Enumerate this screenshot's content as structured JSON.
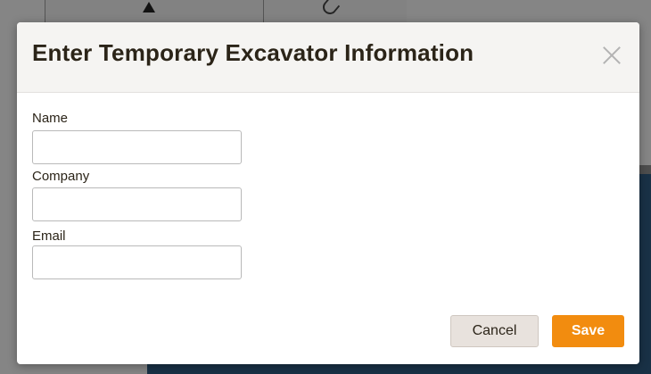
{
  "dialog": {
    "title": "Enter Temporary Excavator Information",
    "close_icon": "close-icon",
    "fields": [
      {
        "label": "Name",
        "value": "",
        "placeholder": ""
      },
      {
        "label": "Company",
        "value": "",
        "placeholder": ""
      },
      {
        "label": "Email",
        "value": "",
        "placeholder": ""
      }
    ],
    "buttons": {
      "cancel_label": "Cancel",
      "save_label": "Save"
    }
  },
  "colors": {
    "accent": "#f28c0f",
    "title_text": "#2b2418",
    "header_bg": "#f5f4f2",
    "cancel_bg": "#e8e2dd",
    "backdrop_panel": "#2e5a80"
  },
  "background": {
    "icons": [
      "warning-icon",
      "paperclip-icon"
    ]
  }
}
